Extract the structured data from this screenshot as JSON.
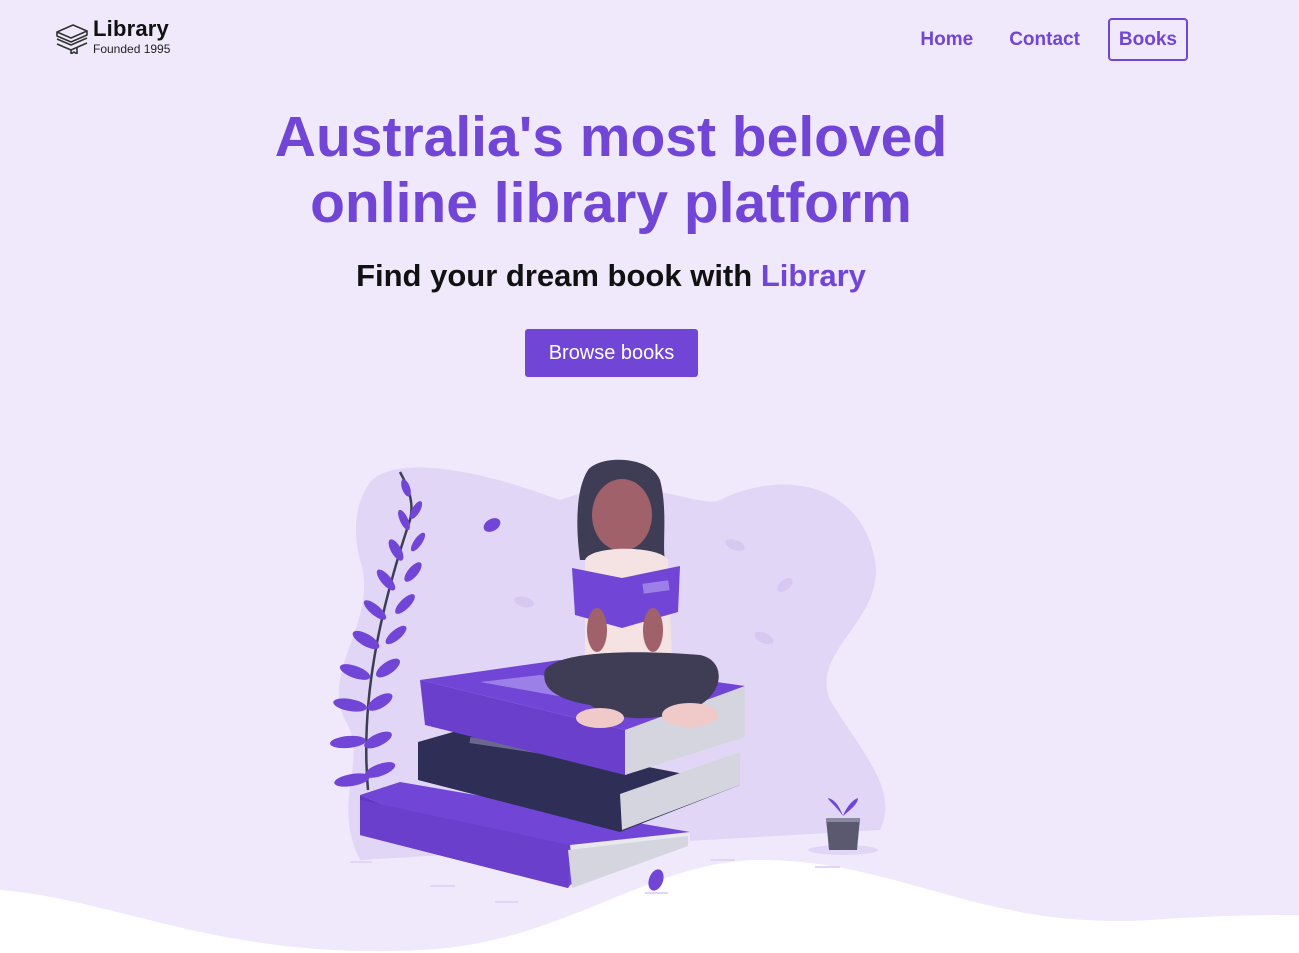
{
  "brand": {
    "name": "Library",
    "tagline": "Founded 1995",
    "logo_icon": "stacked-books-icon"
  },
  "nav": {
    "items": [
      {
        "label": "Home"
      },
      {
        "label": "Contact"
      },
      {
        "label": "Books",
        "active": true
      }
    ]
  },
  "hero": {
    "title_line1": "Australia's most beloved",
    "title_line2": "online library platform",
    "subtitle_prefix": "Find your dream book with ",
    "subtitle_accent": "Library",
    "cta_label": "Browse books"
  },
  "illustration": "woman-reading-on-book-stack",
  "colors": {
    "accent": "#7145d6",
    "background": "#f0e9fb",
    "blob": "#e2d6f6",
    "dark_book": "#2f2e56"
  }
}
